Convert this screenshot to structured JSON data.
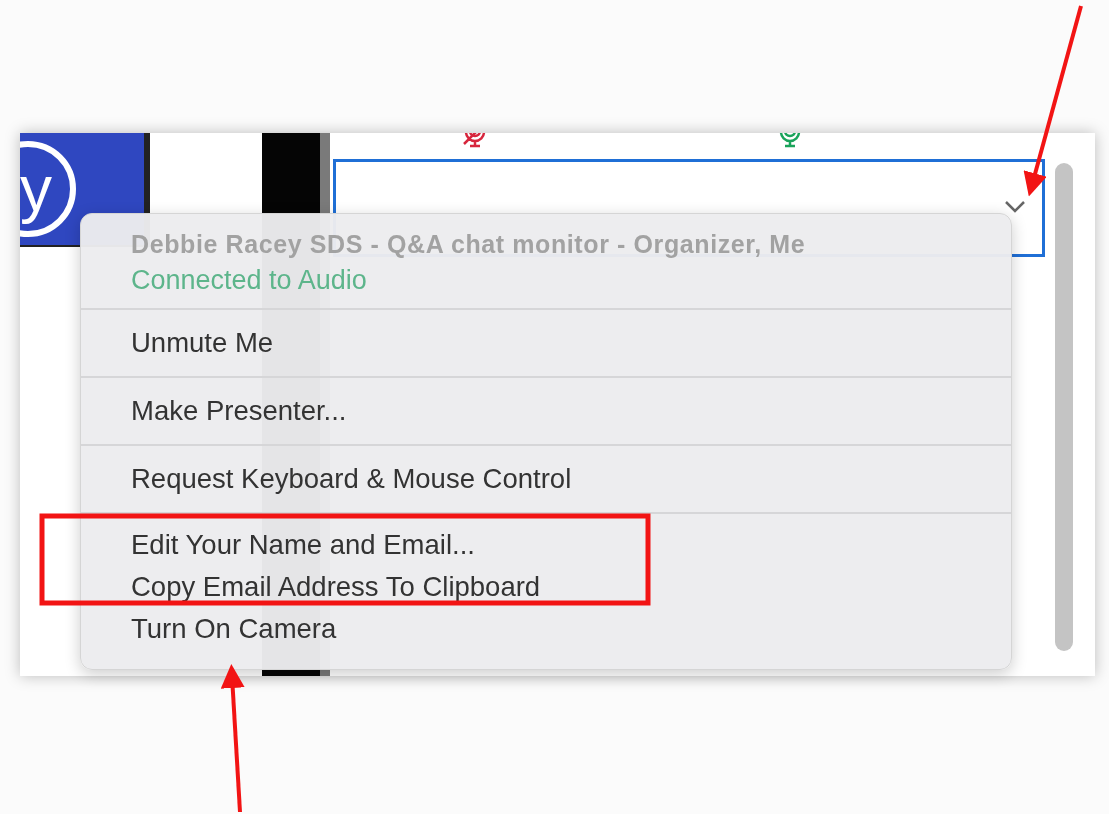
{
  "logo": {
    "text": "y"
  },
  "toolbar": {
    "buttons": [
      {
        "kind": "mute"
      },
      {
        "kind": "unmute"
      }
    ]
  },
  "menu": {
    "header": {
      "name": "Debbie Racey SDS - Q&A chat monitor - Organizer, Me",
      "status": "Connected to Audio"
    },
    "groups": [
      [
        "Unmute Me"
      ],
      [
        "Make Presenter..."
      ],
      [
        "Request Keyboard & Mouse Control"
      ],
      [
        "Edit Your Name and Email...",
        "Copy Email Address To Clipboard",
        "Turn On Camera"
      ]
    ]
  }
}
